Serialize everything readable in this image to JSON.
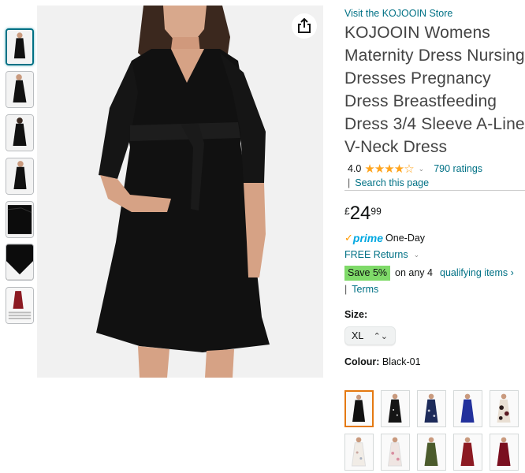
{
  "gallery": {
    "thumbnails": [
      {
        "name": "thumb-front",
        "selected": true
      },
      {
        "name": "thumb-side",
        "selected": false
      },
      {
        "name": "thumb-back",
        "selected": false
      },
      {
        "name": "thumb-three-quarter",
        "selected": false
      },
      {
        "name": "thumb-fabric",
        "selected": false
      },
      {
        "name": "thumb-neck-detail",
        "selected": false
      },
      {
        "name": "thumb-size-chart",
        "selected": false
      }
    ],
    "share_icon": "share-icon"
  },
  "product": {
    "store_link": "Visit the KOJOOIN Store",
    "title": "KOJOOIN Womens Maternity Dress Nursing Dresses Pregnancy Dress Breastfeeding Dress 3/4 Sleeve A-Line V-Neck Dress",
    "rating_value": "4.0",
    "stars": "star-rating-icon",
    "ratings_count": "790 ratings",
    "search_separator": "|",
    "search_link": "Search this page",
    "price_currency": "£",
    "price_whole": "24",
    "price_fraction": "99",
    "prime_check": "✓",
    "prime_label": "prime",
    "prime_delivery": "One-Day",
    "returns_label": "FREE Returns",
    "promo_badge": "Save 5%",
    "promo_text": "on any 4",
    "promo_link": "qualifying items ›",
    "terms_separator": "|",
    "terms_link": "Terms",
    "size_label": "Size:",
    "size_value": "XL",
    "colour_label": "Colour:",
    "colour_value": "Black-01"
  },
  "colors": {
    "link": "#007185",
    "star": "#ffa41c",
    "prime": "#00a8e1",
    "save_badge": "#7fda69",
    "selected_swatch": "#e47911"
  },
  "swatches": [
    {
      "name": "swatch-black-01",
      "selected": true,
      "color": "#111111"
    },
    {
      "name": "swatch-black-white-dot",
      "selected": false,
      "color": "#151515"
    },
    {
      "name": "swatch-navy-floral",
      "selected": false,
      "color": "#1d2b5a"
    },
    {
      "name": "swatch-royal-blue",
      "selected": false,
      "color": "#23319c"
    },
    {
      "name": "swatch-white-floral-dark",
      "selected": false,
      "color": "#e9dfd3"
    },
    {
      "name": "swatch-white-floral",
      "selected": false,
      "color": "#f1ece6"
    },
    {
      "name": "swatch-white-pink-floral",
      "selected": false,
      "color": "#efe5e2"
    },
    {
      "name": "swatch-army-green",
      "selected": false,
      "color": "#4b5b2c"
    },
    {
      "name": "swatch-wine-red",
      "selected": false,
      "color": "#8c1a22"
    },
    {
      "name": "swatch-burgundy",
      "selected": false,
      "color": "#7a0f1f"
    }
  ]
}
